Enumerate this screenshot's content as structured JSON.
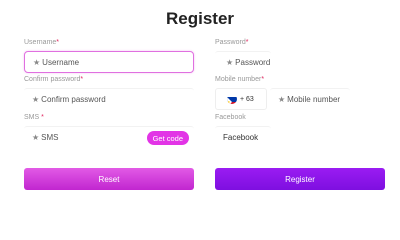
{
  "header": {
    "title": "Register"
  },
  "form": {
    "username": {
      "label": "Username",
      "required_mark": "*",
      "placeholder": "Username"
    },
    "password": {
      "label": "Password",
      "required_mark": "*",
      "placeholder": "Password"
    },
    "confirm_password": {
      "label": "Confirm password",
      "required_mark": "*",
      "placeholder": "Confirm password"
    },
    "mobile": {
      "label": "Mobile number",
      "required_mark": "*",
      "placeholder": "Mobile number",
      "country_code": "+ 63"
    },
    "sms": {
      "label": "SMS",
      "required_mark": "*",
      "placeholder": "SMS",
      "get_code_label": "Get code"
    },
    "facebook": {
      "label": "Facebook",
      "value": "Facebook"
    },
    "placeholder_star": "★"
  },
  "actions": {
    "reset_label": "Reset",
    "register_label": "Register"
  },
  "colors": {
    "accent_pink": "#e234e6",
    "accent_purple": "#8a15e8",
    "required": "#e0245e"
  }
}
